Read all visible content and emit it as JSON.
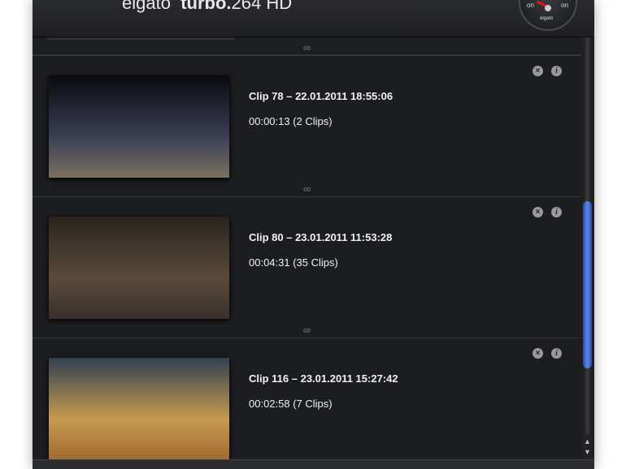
{
  "header": {
    "brand": "elgato",
    "product": "turbo.",
    "product_suffix": "264 HD",
    "gauge_on_left": "on",
    "gauge_on_right": "on",
    "gauge_brand": "elgato"
  },
  "clips": [
    {
      "title": "Clip 78 – 22.01.2011 18:55:06",
      "duration": "00:00:13 (2 Clips)",
      "colors": [
        "#0a0a10",
        "#3a3f55",
        "#7a7060"
      ]
    },
    {
      "title": "Clip 80 – 23.01.2011 11:53:28",
      "duration": "00:04:31 (35 Clips)",
      "colors": [
        "#2a241e",
        "#5a4a3a",
        "#3a302a"
      ]
    },
    {
      "title": "Clip 116 – 23.01.2011 15:27:42",
      "duration": "00:02:58 (7 Clips)",
      "colors": [
        "#304050",
        "#c89a50",
        "#a06a30"
      ]
    }
  ],
  "icons": {
    "delete": "close-circle-icon",
    "info": "info-circle-icon",
    "link": "chain-link-icon"
  },
  "accent": "#4a78e0"
}
